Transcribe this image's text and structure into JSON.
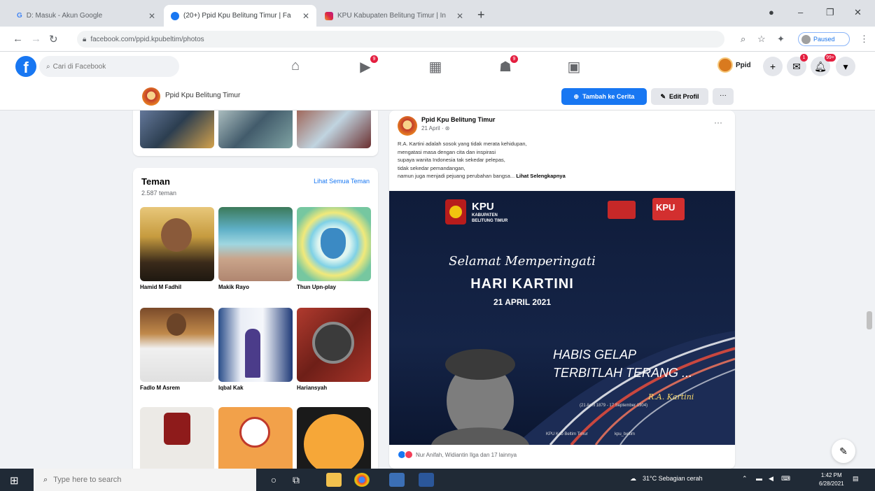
{
  "browser": {
    "tabs": [
      {
        "title": "D: Masuk - Akun Google",
        "active": false
      },
      {
        "title": "(20+) Ppid Kpu Belitung Timur | Fa",
        "active": true
      },
      {
        "title": "KPU Kabupaten Belitung Timur | In",
        "active": false
      }
    ],
    "url": "facebook.com/ppid.kpubeltim/photos",
    "profile_label": "Paused"
  },
  "fb_header": {
    "search_placeholder": "Cari di Facebook",
    "nav_badges": {
      "watch": "9",
      "groups": "9"
    },
    "profile_name": "Ppid",
    "notif_badge": "99+",
    "messenger_badge": "1"
  },
  "profile_bar": {
    "name": "Ppid Kpu Belitung Timur",
    "add_story_label": "Tambah ke Cerita",
    "edit_profile_label": "Edit Profil",
    "more_label": "···"
  },
  "friends": {
    "title": "Teman",
    "count": "2.587 teman",
    "see_all": "Lihat Semua Teman",
    "items": [
      {
        "name": "Hamid M Fadhil"
      },
      {
        "name": "Makik Rayo"
      },
      {
        "name": "Thun Upn-play"
      },
      {
        "name": "Fadlo M Asrem"
      },
      {
        "name": "Iqbal Kak"
      },
      {
        "name": "Hariansyah"
      }
    ]
  },
  "post": {
    "author": "Ppid Kpu Belitung Timur",
    "time": "21 April · ⊛",
    "text_lines": [
      "R.A. Kartini adalah sosok yang tidak merata kehidupan,",
      "mengatasi masa dengan cita dan inspirasi",
      "supaya wanita Indonesia tak sekedar pelepas,",
      "tidak sekedar pemandangan,",
      "namun juga menjadi pejuang perubahan bangsa..."
    ],
    "more_link": "Lihat Selengkapnya",
    "reactions_text": "Nur Anifah, Widiantin Ilga dan 17 lainnya",
    "image": {
      "logo_title": "KPU",
      "logo_sub1": "KABUPATEN",
      "logo_sub2": "BELITUNG TIMUR",
      "badge": "KPU",
      "heading_script": "Selamat Memperingati",
      "heading_main": "HARI KARTINI",
      "date": "21 APRIL 2021",
      "quote1": "HABIS GELAP",
      "quote2": "TERBITLAH TERANG ...",
      "signature": "R.A. Kartini",
      "lifespan": "(21 April 1879 - 17 September 1904)",
      "footer_left": "KPU Kab Beltim Timur",
      "footer_right": "kpu_beltim"
    }
  },
  "taskbar": {
    "search_placeholder": "Type here to search",
    "weather": "31°C  Sebagian cerah",
    "time": "1:42 PM",
    "date": "6/28/2021"
  },
  "colors": {
    "fb_blue": "#1877f2",
    "badge_red": "#e41e3f",
    "poster_navy": "#0f1c3a"
  }
}
